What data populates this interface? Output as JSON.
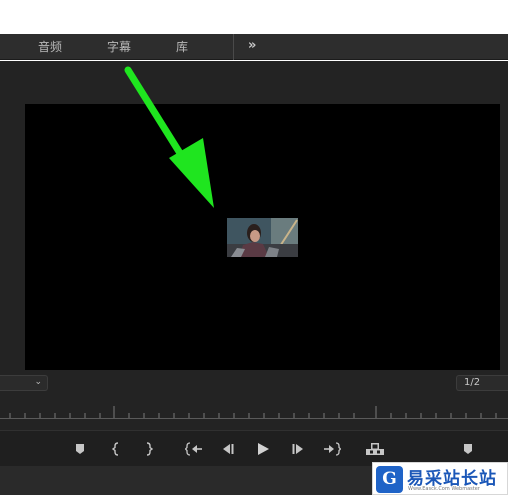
{
  "tabs": [
    {
      "label": "音频"
    },
    {
      "label": "字幕"
    },
    {
      "label": "库"
    }
  ],
  "more_tabs_glyph": "»",
  "program_monitor": {
    "dropdown_chevron": "⌄",
    "page_counter": "1/2"
  },
  "transport_controls": [
    "add-marker-icon",
    "mark-in-icon",
    "mark-out-icon",
    "go-to-in-icon",
    "step-back-icon",
    "play-icon",
    "step-forward-icon",
    "go-to-out-icon",
    "export-frame-icon",
    "marker-right-icon"
  ],
  "annotation": {
    "arrow_color": "#1fe51f"
  },
  "watermark": {
    "logo_glyph": "G",
    "title": "易采站长站",
    "subtitle": "Www.Easck.Com  Webmaster"
  }
}
